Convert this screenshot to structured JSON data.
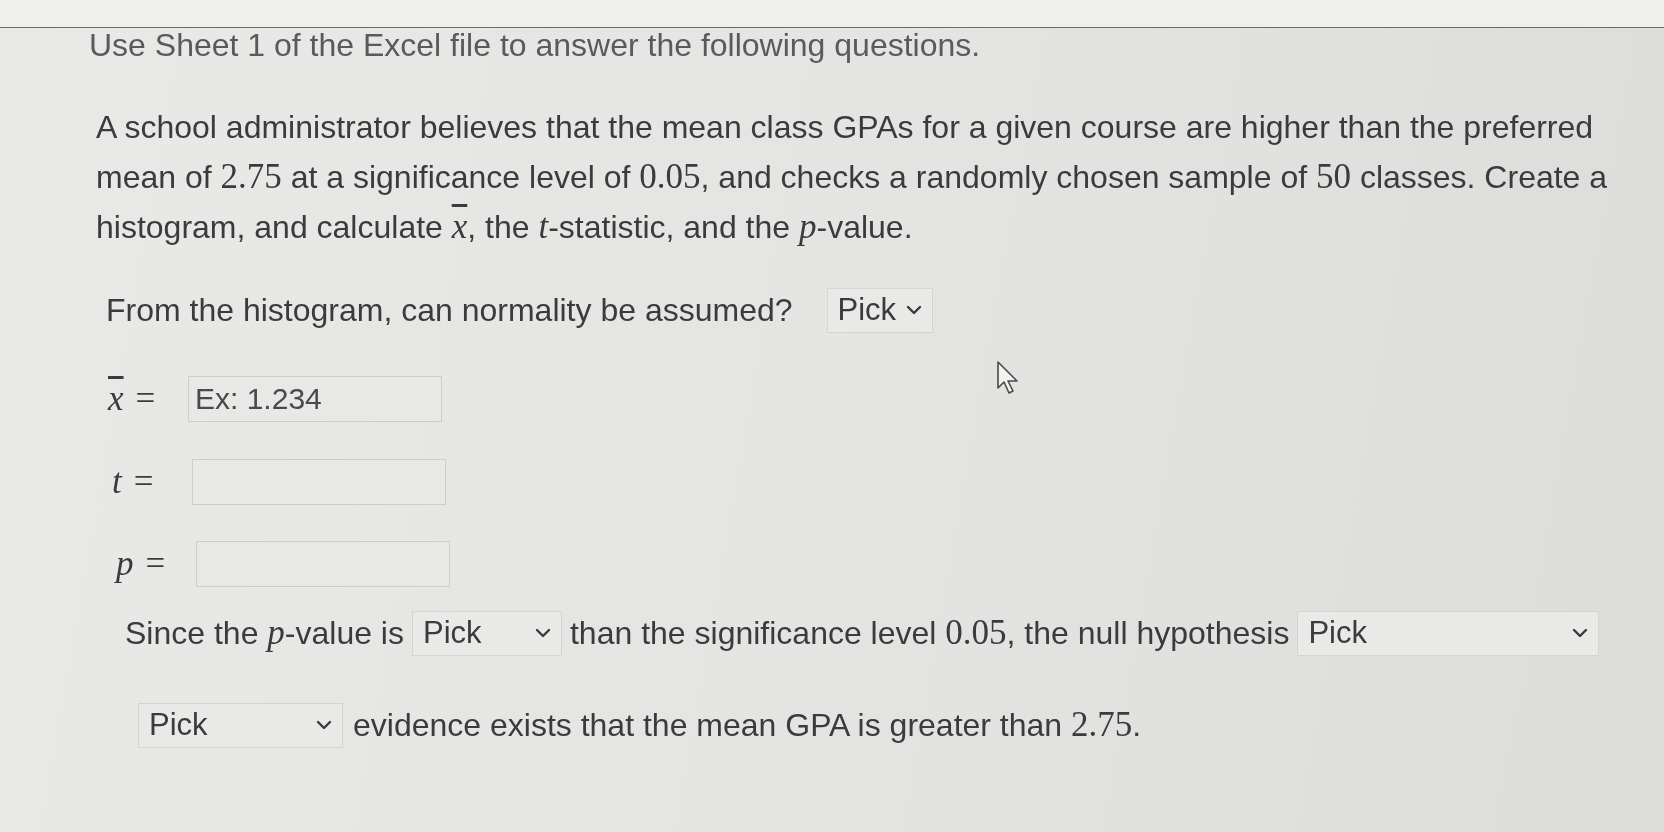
{
  "header": {
    "text": "Use Sheet 1 of the Excel file to answer the following questions."
  },
  "problem": {
    "segments": [
      {
        "kind": "text",
        "text": "A school administrator believes that the mean class GPAs for a given course are higher than the preferred mean of "
      },
      {
        "kind": "number",
        "text": "2.75"
      },
      {
        "kind": "text",
        "text": " at a significance level of "
      },
      {
        "kind": "number",
        "text": "0.05"
      },
      {
        "kind": "text",
        "text": ", and checks a randomly chosen sample of "
      },
      {
        "kind": "number",
        "text": "50"
      },
      {
        "kind": "text",
        "text": " classes. Create a histogram, and calculate "
      },
      {
        "kind": "variable_bar",
        "text": "x"
      },
      {
        "kind": "text",
        "text": ", the "
      },
      {
        "kind": "variable",
        "text": "t"
      },
      {
        "kind": "text",
        "text": "-statistic, and the "
      },
      {
        "kind": "variable",
        "text": "p"
      },
      {
        "kind": "text",
        "text": "-value."
      }
    ]
  },
  "questions": [
    {
      "kind": "choice",
      "label": [
        {
          "kind": "text",
          "text": "From the histogram, can normality be assumed?"
        }
      ],
      "select": {
        "value": "Pick"
      }
    },
    {
      "kind": "answer",
      "variable": {
        "kind": "variable_bar",
        "text": "x"
      },
      "equals": "=",
      "placeholder": "Ex: 1.234"
    },
    {
      "kind": "answer",
      "variable": {
        "kind": "variable",
        "text": "t"
      },
      "equals": "="
    },
    {
      "kind": "answer",
      "variable": {
        "kind": "variable",
        "text": "p"
      },
      "equals": "="
    },
    {
      "kind": "sentence",
      "parts": [
        {
          "kind": "text",
          "segments": [
            {
              "kind": "text",
              "text": "Since the "
            },
            {
              "kind": "variable",
              "text": "p"
            },
            {
              "kind": "text",
              "text": "-value is"
            }
          ]
        },
        {
          "kind": "select",
          "value": "Pick"
        },
        {
          "kind": "text",
          "segments": [
            {
              "kind": "text",
              "text": "than the significance level "
            },
            {
              "kind": "number",
              "text": "0.05"
            },
            {
              "kind": "text",
              "text": ", the null hypothesis"
            }
          ]
        },
        {
          "kind": "select",
          "value": "Pick"
        }
      ]
    },
    {
      "kind": "sentence",
      "parts": [
        {
          "kind": "select",
          "value": "Pick"
        },
        {
          "kind": "text",
          "segments": [
            {
              "kind": "text",
              "text": "evidence exists that the mean GPA is greater than "
            },
            {
              "kind": "number",
              "text": "2.75"
            },
            {
              "kind": "text",
              "text": "."
            }
          ]
        }
      ]
    }
  ]
}
